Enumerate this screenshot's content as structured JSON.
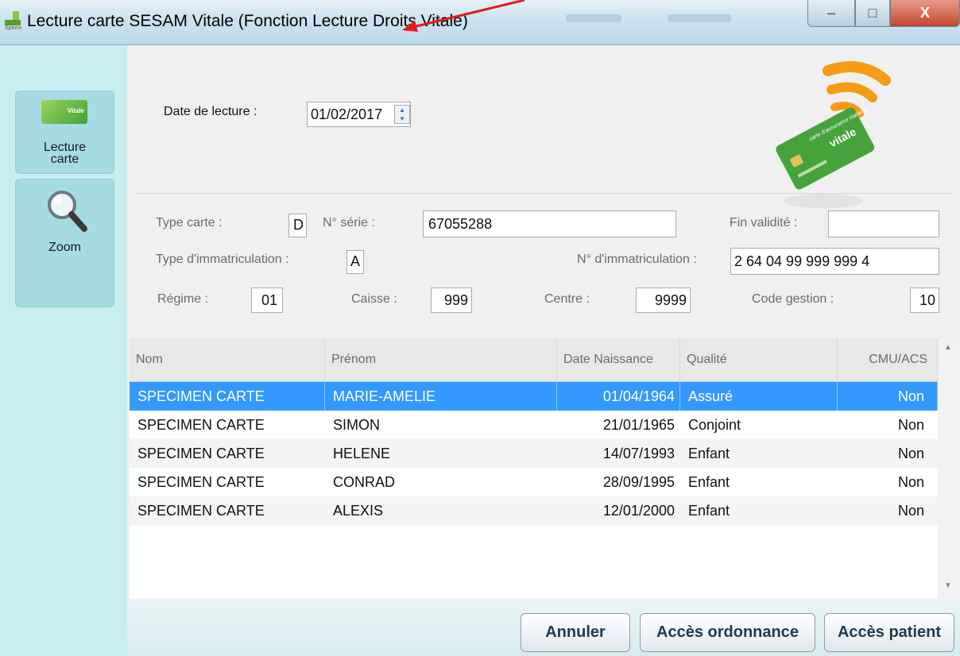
{
  "window": {
    "title": "Lecture carte SESAM Vitale (Fonction Lecture Droits Vitale)",
    "minimize": "–",
    "maximize": "□",
    "close": "X"
  },
  "sidebar": {
    "items": [
      {
        "label_line1": "Lecture",
        "label_line2": "carte",
        "icon": "vitale-card-icon",
        "card_text": "Vitale"
      },
      {
        "label": "Zoom",
        "icon": "magnifier-icon"
      }
    ]
  },
  "form": {
    "date_label": "Date de lecture :",
    "date_value": "01/02/2017",
    "type_carte_label": "Type carte :",
    "type_carte_value": "D",
    "serie_label": "N° série :",
    "serie_value": "67055288",
    "fin_validite_label": "Fin validité :",
    "fin_validite_value": "",
    "type_immat_label": "Type d'immatriculation :",
    "type_immat_value": "A",
    "num_immat_label": "N° d'immatriculation :",
    "num_immat_value": "2 64 04 99 999 999  4",
    "regime_label": "Régime :",
    "regime_value": "01",
    "caisse_label": "Caisse :",
    "caisse_value": "999",
    "centre_label": "Centre :",
    "centre_value": "9999",
    "code_gestion_label": "Code gestion :",
    "code_gestion_value": "10"
  },
  "card_image": {
    "line1": "carte d'assurance maladie",
    "line2": "vitale"
  },
  "table": {
    "columns": [
      "Nom",
      "Prénom",
      "Date Naissance",
      "Qualité",
      "CMU/ACS"
    ],
    "rows": [
      {
        "nom": "SPECIMEN CARTE",
        "prenom": "MARIE-AMELIE",
        "date": "01/04/1964",
        "qualite": "Assuré",
        "cmu": "Non"
      },
      {
        "nom": "SPECIMEN CARTE",
        "prenom": "SIMON",
        "date": "21/01/1965",
        "qualite": "Conjoint",
        "cmu": "Non"
      },
      {
        "nom": "SPECIMEN CARTE",
        "prenom": "HELENE",
        "date": "14/07/1993",
        "qualite": "Enfant",
        "cmu": "Non"
      },
      {
        "nom": "SPECIMEN CARTE",
        "prenom": "CONRAD",
        "date": "28/09/1995",
        "qualite": "Enfant",
        "cmu": "Non"
      },
      {
        "nom": "SPECIMEN CARTE",
        "prenom": "ALEXIS",
        "date": "12/01/2000",
        "qualite": "Enfant",
        "cmu": "Non"
      }
    ],
    "selected_row": 0
  },
  "buttons": {
    "annuler": "Annuler",
    "ordonnance": "Accès ordonnance",
    "patient": "Accès patient"
  },
  "colors": {
    "selection": "#3399ff",
    "sidebar": "#c9edf1",
    "annotation_arrow": "#e8191b"
  }
}
